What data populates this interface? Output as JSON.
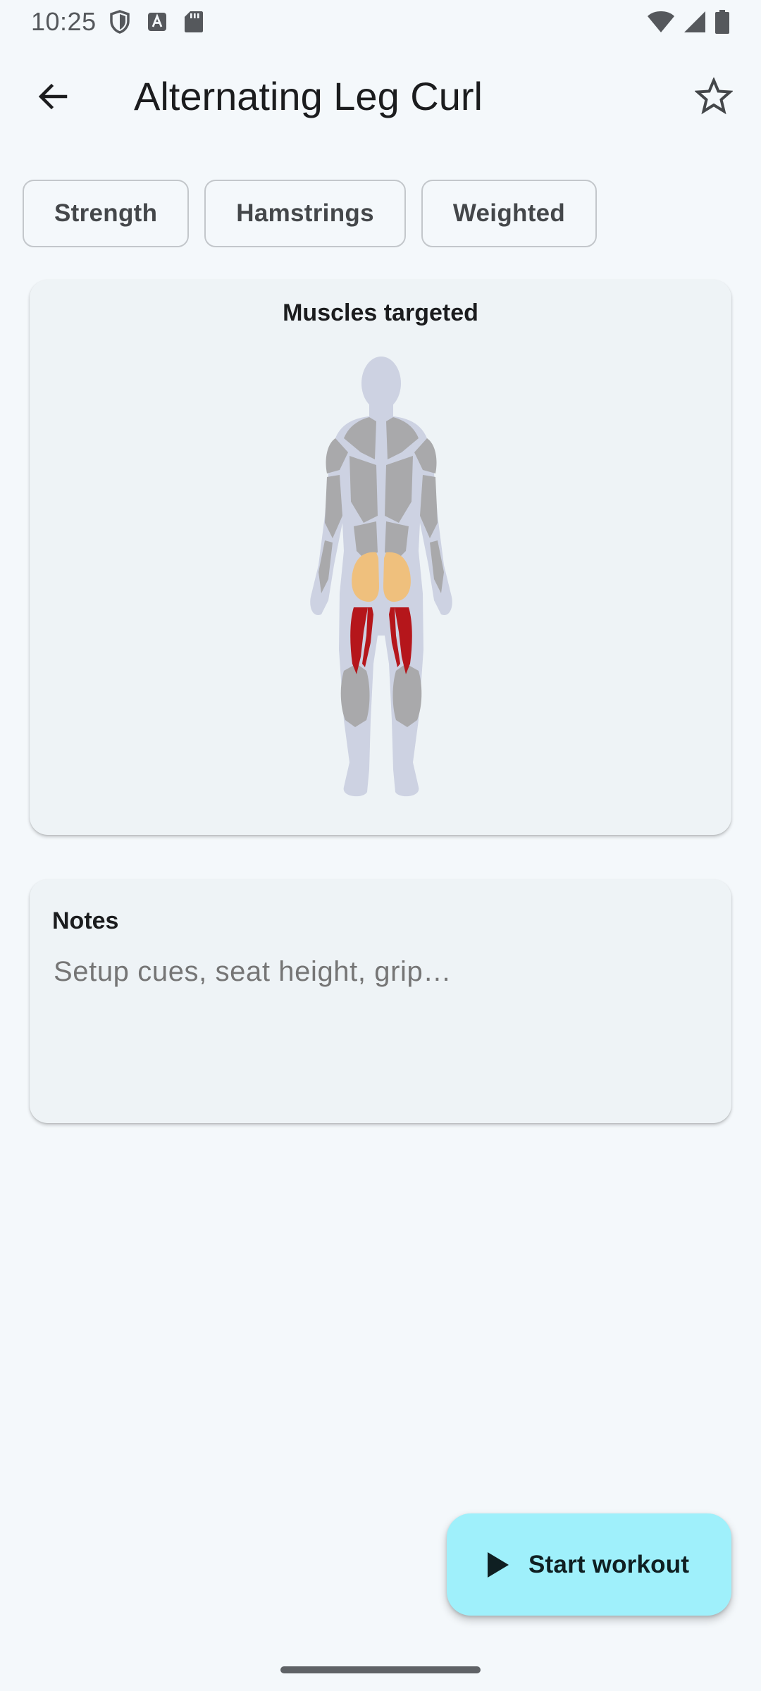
{
  "status_bar": {
    "time": "10:25",
    "icons": [
      "shield-icon",
      "a-notification-icon",
      "sd-card-icon",
      "wifi-icon",
      "cell-signal-icon",
      "battery-icon"
    ]
  },
  "app_bar": {
    "title": "Alternating Leg Curl",
    "back_icon": "arrow-back-icon",
    "favorite_icon": "star-outline-icon"
  },
  "chips": [
    {
      "label": "Strength"
    },
    {
      "label": "Hamstrings"
    },
    {
      "label": "Weighted"
    }
  ],
  "muscles_card": {
    "title": "Muscles targeted",
    "primary_muscle_color": "#b5161b",
    "secondary_muscle_color": "#efc07d",
    "inactive_muscle_color": "#a9a9ab",
    "body_color": "#cdd2e2"
  },
  "notes_card": {
    "title": "Notes",
    "placeholder": "Setup cues, seat height, grip…",
    "value": ""
  },
  "fab": {
    "label": "Start workout",
    "icon": "play-icon",
    "color": "#9ff0fb"
  }
}
